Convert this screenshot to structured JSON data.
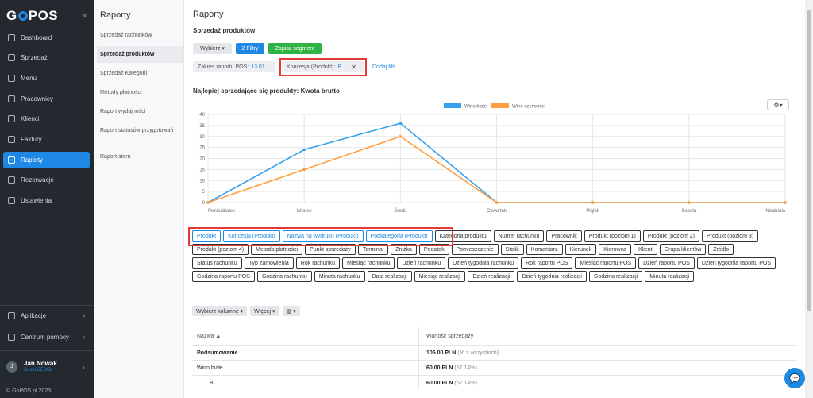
{
  "nav": {
    "logo": "GoPOS",
    "items": [
      {
        "label": "Dashboard"
      },
      {
        "label": "Sprzedaż"
      },
      {
        "label": "Menu"
      },
      {
        "label": "Pracownicy"
      },
      {
        "label": "Klienci"
      },
      {
        "label": "Faktury"
      },
      {
        "label": "Raporty"
      },
      {
        "label": "Rezerwacje"
      },
      {
        "label": "Ustawienia"
      }
    ],
    "bottom": [
      {
        "label": "Aplikacje"
      },
      {
        "label": "Centrum pomocy"
      }
    ],
    "user": {
      "initial": "J",
      "name": "Jan Nowak",
      "org": "Sushi DEMO"
    },
    "copyright": "© GoPOS.pl 2023"
  },
  "sub": {
    "title": "Raporty",
    "items": [
      {
        "label": "Sprzedaż rachunków"
      },
      {
        "label": "Sprzedaż produktów"
      },
      {
        "label": "Sprzedaż Kategorii"
      },
      {
        "label": "Metody płatności"
      },
      {
        "label": "Raport wydajności"
      },
      {
        "label": "Raport statusów przygotowań"
      },
      {
        "label": "Raport storn"
      }
    ]
  },
  "main": {
    "title": "Raporty",
    "subtitle": "Sprzedaż produktów",
    "buttons": {
      "select": "Wybierz ▾",
      "filters": "2 Filtry",
      "save": "Zapisz segment"
    },
    "filters": {
      "range_label": "Zakres raportu POS:",
      "range_value": "13.01...",
      "concession_label": "Koncesja (Produkt):",
      "concession_value": "B",
      "close": "✕",
      "add": "Dodaj filtr"
    },
    "chart_heading": "Najlepiej sprzedające się produkty: Kwota brutto"
  },
  "chart_data": {
    "type": "line",
    "categories": [
      "Poniedziałek",
      "Wtorek",
      "Środa",
      "Czwartek",
      "Piątek",
      "Sobota",
      "Niedziela"
    ],
    "series": [
      {
        "name": "Wino białe",
        "color": "#36a2eb",
        "values": [
          0,
          24,
          36,
          0,
          0,
          0,
          0
        ]
      },
      {
        "name": "Wino czerwone",
        "color": "#ff9f40",
        "values": [
          0,
          15,
          30,
          0,
          0,
          0,
          0
        ]
      }
    ],
    "yticks": [
      "0",
      "5",
      "10",
      "15",
      "20",
      "25",
      "30",
      "35",
      "40"
    ],
    "ylim": [
      0,
      40
    ],
    "grid": true,
    "legend": "top-center"
  },
  "tags": [
    {
      "label": "Produkt",
      "selected": true
    },
    {
      "label": "Koncesja (Produkt)",
      "selected": true
    },
    {
      "label": "Nazwa na wydruku (Produkt)",
      "selected": true
    },
    {
      "label": "Podkategoria (Produkt)",
      "selected": true
    },
    {
      "label": "Kategoria produktu"
    },
    {
      "label": "Numer rachunku"
    },
    {
      "label": "Pracownik"
    },
    {
      "label": "Produkt (poziom 1)"
    },
    {
      "label": "Produkt (poziom 2)"
    },
    {
      "label": "Produkt (poziom 3)"
    },
    {
      "label": "Produkt (poziom 4)"
    },
    {
      "label": "Metoda płatności"
    },
    {
      "label": "Punkt sprzedaży"
    },
    {
      "label": "Terminal"
    },
    {
      "label": "Zniżka"
    },
    {
      "label": "Podatek"
    },
    {
      "label": "Pomieszczenie"
    },
    {
      "label": "Stolik"
    },
    {
      "label": "Komentarz"
    },
    {
      "label": "Kierunek"
    },
    {
      "label": "Kierowca"
    },
    {
      "label": "Klient"
    },
    {
      "label": "Grupa klientów"
    },
    {
      "label": "Źródło"
    },
    {
      "label": "Status rachunku"
    },
    {
      "label": "Typ zamówienia"
    },
    {
      "label": "Rok rachunku"
    },
    {
      "label": "Miesiąc rachunku"
    },
    {
      "label": "Dzień rachunku"
    },
    {
      "label": "Dzień tygodnia rachunku"
    },
    {
      "label": "Rok raportu POS"
    },
    {
      "label": "Miesiąc raportu POS"
    },
    {
      "label": "Dzień raportu POS"
    },
    {
      "label": "Dzień tygodnia raportu POS"
    },
    {
      "label": "Godzina raportu POS"
    },
    {
      "label": "Godzina rachunku"
    },
    {
      "label": "Minuta rachunku"
    },
    {
      "label": "Data realizacji"
    },
    {
      "label": "Miesiąc realizacji"
    },
    {
      "label": "Dzień realizacji"
    },
    {
      "label": "Dzień tygodnia realizacji"
    },
    {
      "label": "Godzina realizacji"
    },
    {
      "label": "Minuta realizacji"
    }
  ],
  "tools": {
    "columns": "Wybierz kolumnę ▾",
    "more": "Więcej ▾",
    "view": "▥ ▾"
  },
  "table": {
    "col1": "Nazwa ▲",
    "col2": "Wartość sprzedaży",
    "rows": [
      {
        "name": "Podsumowanie",
        "value": "105.00 PLN",
        "pct": "(% z wszystkich)",
        "bold": true
      },
      {
        "name": "Wino białe",
        "value": "60.00 PLN",
        "pct": "(57.14%)"
      },
      {
        "name": "B",
        "value": "60.00 PLN",
        "pct": "(57.14%)",
        "indent": true
      }
    ]
  }
}
